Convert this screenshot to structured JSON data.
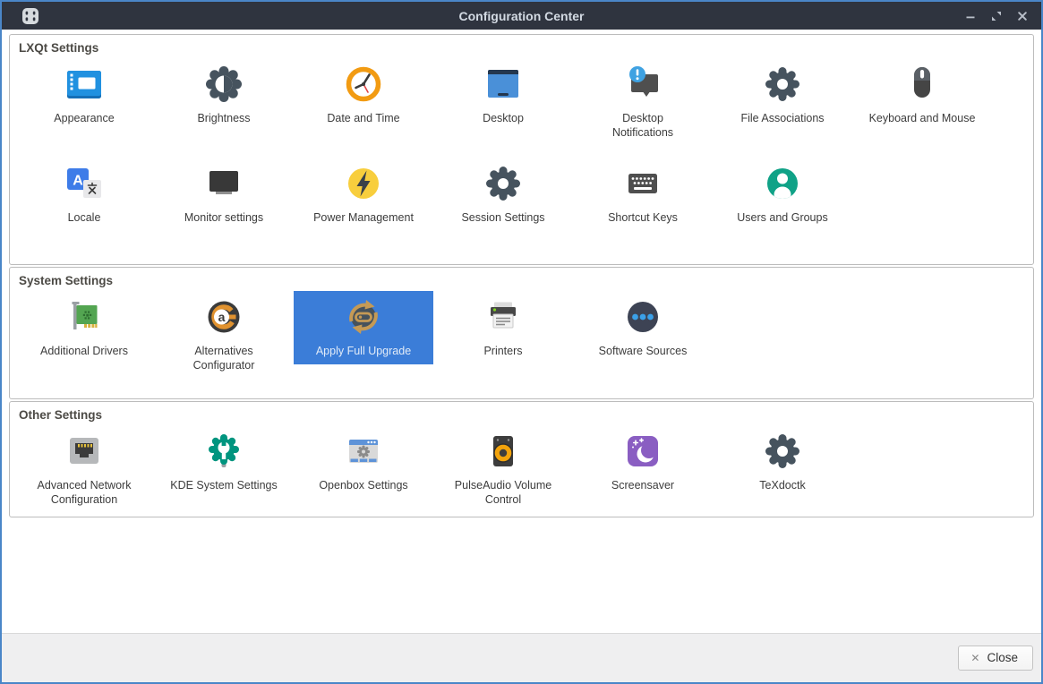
{
  "window": {
    "title": "Configuration Center"
  },
  "titlebar_controls": {
    "minimize": "minimize",
    "maximize": "maximize",
    "close": "close"
  },
  "sections": [
    {
      "title": "LXQt Settings",
      "items": [
        {
          "label": "Appearance",
          "icon": "appearance"
        },
        {
          "label": "Brightness",
          "icon": "brightness"
        },
        {
          "label": "Date and Time",
          "icon": "date-time"
        },
        {
          "label": "Desktop",
          "icon": "desktop"
        },
        {
          "label": "Desktop Notifications",
          "icon": "desktop-notifications",
          "wrap": true
        },
        {
          "label": "File Associations",
          "icon": "file-associations"
        },
        {
          "label": "Keyboard and Mouse",
          "icon": "keyboard-mouse"
        },
        {
          "label": "Locale",
          "icon": "locale"
        },
        {
          "label": "Monitor settings",
          "icon": "monitor-settings"
        },
        {
          "label": "Power Management",
          "icon": "power-management"
        },
        {
          "label": "Session Settings",
          "icon": "session-settings"
        },
        {
          "label": "Shortcut Keys",
          "icon": "shortcut-keys"
        },
        {
          "label": "Users and Groups",
          "icon": "users-groups"
        }
      ]
    },
    {
      "title": "System Settings",
      "items": [
        {
          "label": "Additional Drivers",
          "icon": "additional-drivers"
        },
        {
          "label": "Alternatives Configurator",
          "icon": "alternatives-configurator",
          "wrap": true
        },
        {
          "label": "Apply Full Upgrade",
          "icon": "apply-full-upgrade",
          "selected": true
        },
        {
          "label": "Printers",
          "icon": "printers"
        },
        {
          "label": "Software Sources",
          "icon": "software-sources"
        }
      ]
    },
    {
      "title": "Other Settings",
      "items": [
        {
          "label": "Advanced Network Configuration",
          "icon": "advanced-network",
          "wrap": true
        },
        {
          "label": "KDE System Settings",
          "icon": "kde-settings"
        },
        {
          "label": "Openbox Settings",
          "icon": "openbox-settings"
        },
        {
          "label": "PulseAudio Volume Control",
          "icon": "pulseaudio",
          "wrap": true
        },
        {
          "label": "Screensaver",
          "icon": "screensaver"
        },
        {
          "label": "TeXdoctk",
          "icon": "texdoctk"
        }
      ]
    }
  ],
  "footer": {
    "close_button": {
      "icon": "✕",
      "label": "Close"
    }
  },
  "colors": {
    "window_border_accent": "#4a86c8",
    "titlebar_bg": "#2f343f",
    "titlebar_text": "#d3dae3",
    "selection_bg": "#3b7dd8",
    "selection_text": "#e1ebf8",
    "section_title_text": "#4c4a45",
    "item_label_text": "#3c3c3c",
    "groupbox_border": "#bcbcbc",
    "footer_bg": "#efeff0",
    "content_bg": "#ffffff"
  }
}
